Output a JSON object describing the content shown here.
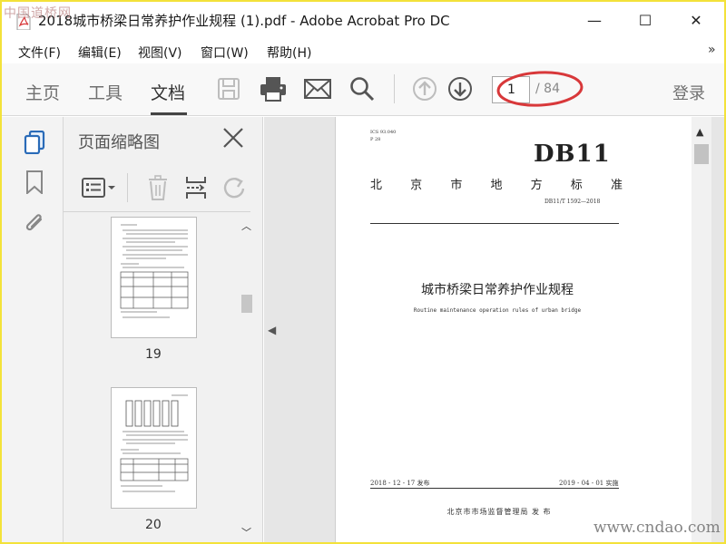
{
  "window": {
    "title": "2018城市桥梁日常养护作业规程 (1).pdf - Adobe Acrobat Pro DC",
    "min": "—",
    "max": "☐",
    "close": "✕"
  },
  "menu": {
    "items": [
      "文件(F)",
      "编辑(E)",
      "视图(V)",
      "窗口(W)",
      "帮助(H)"
    ],
    "more": "»"
  },
  "toolbar": {
    "tabs": [
      "主页",
      "工具",
      "文档"
    ],
    "active_tab": "文档",
    "page_current": "1",
    "page_total": "/ 84",
    "login": "登录",
    "accent": "#d8383a"
  },
  "thumbnails": {
    "title": "页面缩略图",
    "pages": [
      {
        "label": "19"
      },
      {
        "label": "20"
      }
    ]
  },
  "document": {
    "ics": "ICS 93.040",
    "p_code": "P 28",
    "db": "DB11",
    "standard_chars": [
      "北",
      "京",
      "市",
      "地",
      "方",
      "标",
      "准"
    ],
    "code": "DB11/T 1592—2018",
    "title_cn": "城市桥梁日常养护作业规程",
    "title_en": "Routine maintenance operation rules of urban bridge",
    "published": "2018 - 12 - 17 发布",
    "implemented": "2019 - 04 - 01 实施",
    "issuer": "北京市市场监督管理局    发 布"
  },
  "watermarks": {
    "top": "中国道桥网",
    "bottom": "www.cndao.com"
  }
}
